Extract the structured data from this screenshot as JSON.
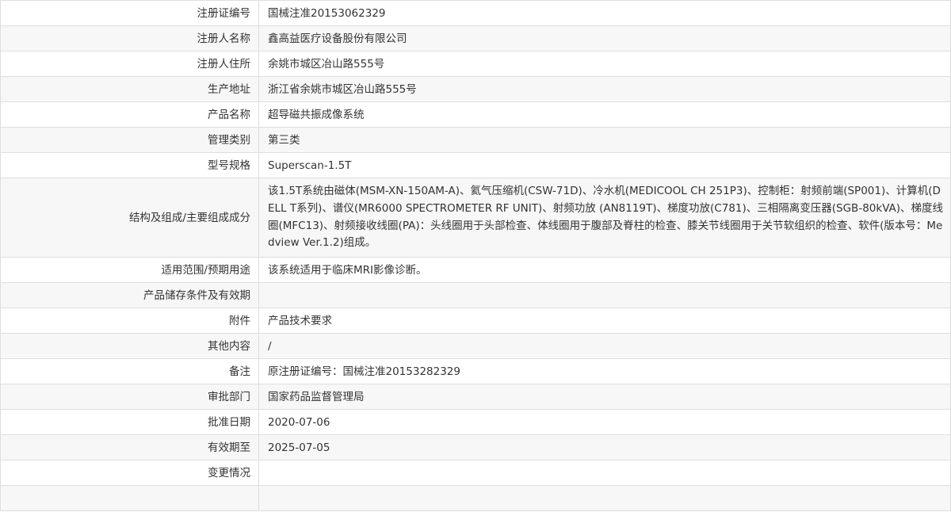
{
  "rows": [
    {
      "label": "注册证编号",
      "value": "国械注准20153062329"
    },
    {
      "label": "注册人名称",
      "value": "鑫高益医疗设备股份有限公司"
    },
    {
      "label": "注册人住所",
      "value": "余姚市城区冶山路555号"
    },
    {
      "label": "生产地址",
      "value": "浙江省余姚市城区冶山路555号"
    },
    {
      "label": "产品名称",
      "value": "超导磁共振成像系统"
    },
    {
      "label": "管理类别",
      "value": "第三类"
    },
    {
      "label": "型号规格",
      "value": "Superscan-1.5T"
    },
    {
      "label": "结构及组成/主要组成成分",
      "value": "该1.5T系统由磁体(MSM-XN-150AM-A)、氦气压缩机(CSW-71D)、冷水机(MEDICOOL CH 251P3)、控制柜：射频前端(SP001)、计算机(DELL T系列)、谱仪(MR6000 SPECTROMETER RF UNIT)、射频功放 (AN8119T)、梯度功放(C781)、三相隔离变压器(SGB-80kVA)、梯度线圈(MFC13)、射频接收线圈(PA)：头线圈用于头部检查、体线圈用于腹部及脊柱的检查、膝关节线圈用于关节软组织的检查、软件(版本号：Medview Ver.1.2)组成。"
    },
    {
      "label": "适用范围/预期用途",
      "value": "该系统适用于临床MRI影像诊断。"
    },
    {
      "label": "产品储存条件及有效期",
      "value": ""
    },
    {
      "label": "附件",
      "value": "产品技术要求"
    },
    {
      "label": "其他内容",
      "value": "/"
    },
    {
      "label": "备注",
      "value": "原注册证编号：国械注准20153282329"
    },
    {
      "label": "审批部门",
      "value": "国家药品监督管理局"
    },
    {
      "label": "批准日期",
      "value": "2020-07-06"
    },
    {
      "label": "有效期至",
      "value": "2025-07-05"
    },
    {
      "label": "变更情况",
      "value": ""
    },
    {
      "label": "",
      "value": ""
    }
  ]
}
